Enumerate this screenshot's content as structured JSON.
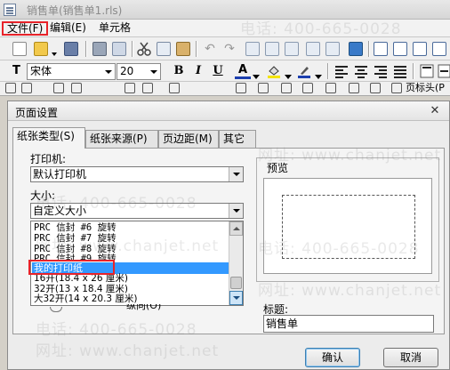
{
  "window": {
    "title": "销售单(销售单1.rls)"
  },
  "menu": {
    "file": "文件(F)",
    "edit": "编辑(E)",
    "cell": "单元格"
  },
  "format_toolbar": {
    "font_name": "宋体",
    "font_size": "20",
    "bold": "B",
    "italic": "I",
    "underline": "U",
    "font_color_letter": "A",
    "font_color": "#1c3fae",
    "fill_color": "#f4e400",
    "pen_color": "#1c3fae"
  },
  "toolbar3": {
    "cut_off_text": "页标头(P"
  },
  "watermark": {
    "phone": "电话: 400-665-0028",
    "site": "网址: www.chanjet.net"
  },
  "dialog": {
    "title": "页面设置",
    "tabs": [
      "纸张类型(S)",
      "纸张来源(P)",
      "页边距(M)",
      "其它"
    ],
    "printer_label": "打印机:",
    "printer_value": "默认打印机",
    "size_label": "大小:",
    "size_value": "自定义大小",
    "paper_list": [
      "PRC 信封 #6 旋转",
      "PRC 信封 #7 旋转",
      "PRC 信封 #8 旋转",
      "PRC 信封 #9 旋转",
      "我的打印纸",
      "16开(18.4 x 26 厘米)",
      "32开(13 x 18.4 厘米)",
      "大32开(14 x 20.3 厘米)"
    ],
    "selected_paper": "我的打印纸",
    "hidden_fragment": "纵向(O)",
    "preview_label": "预览",
    "title_field_label": "标题:",
    "title_field_value": "销售单",
    "ok_label": "确认",
    "cancel_label": "取消"
  }
}
